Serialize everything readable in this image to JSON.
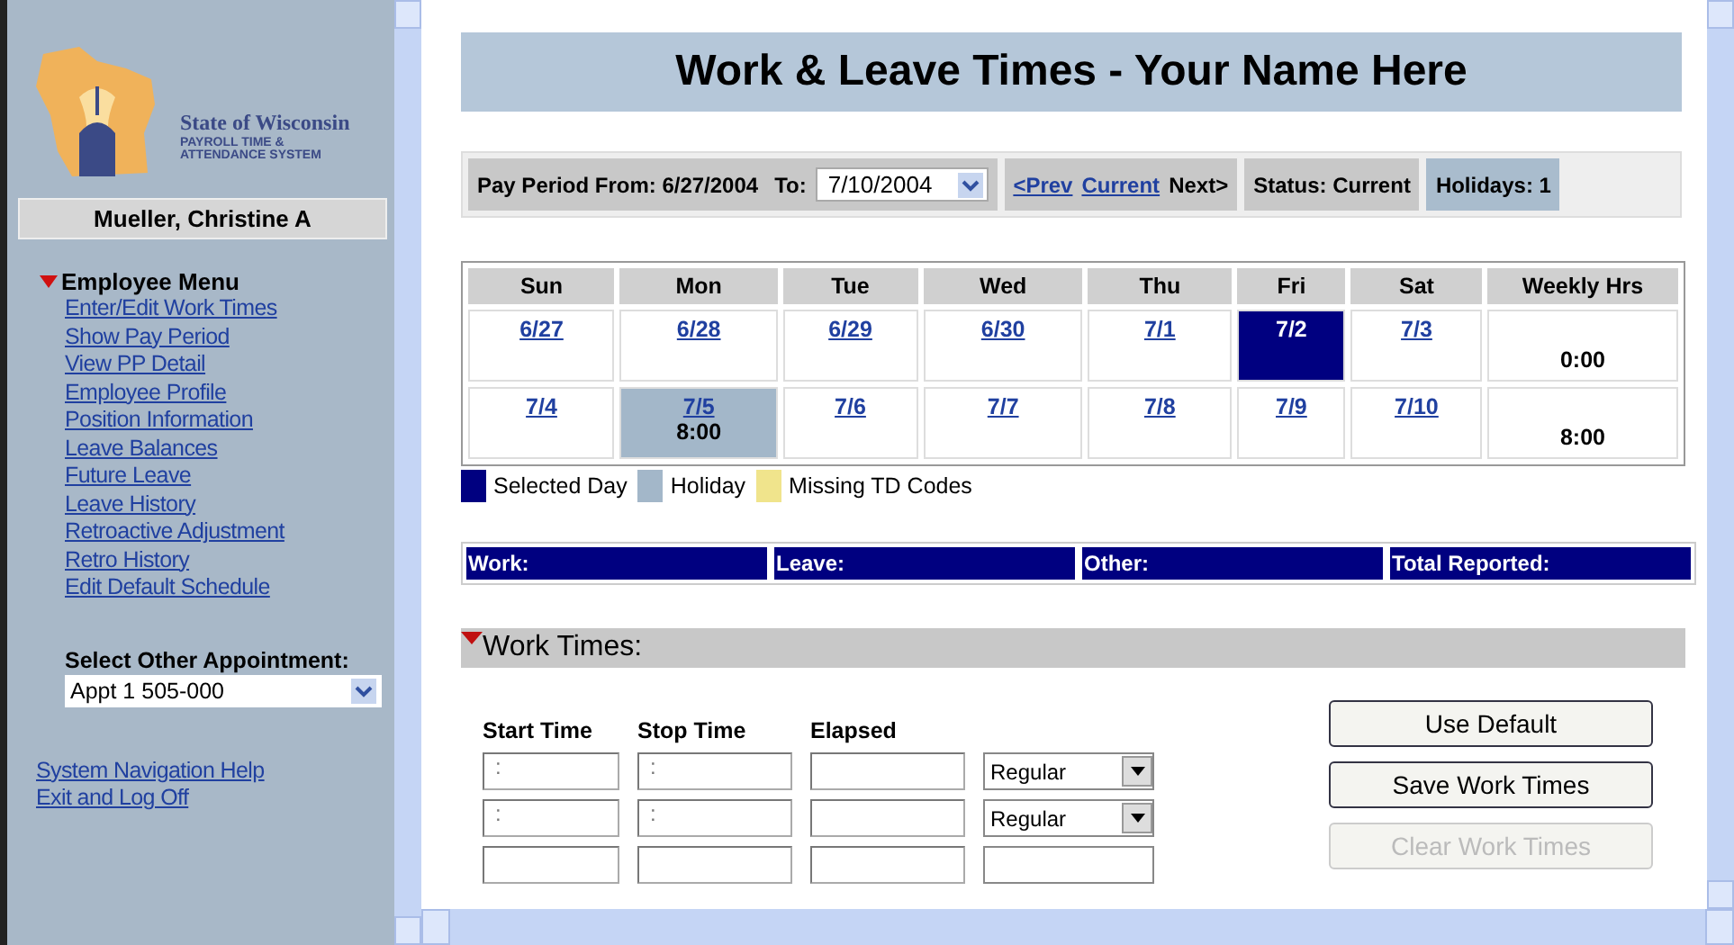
{
  "sidebar": {
    "logo": {
      "title": "State of Wisconsin",
      "subtitle_1": "PAYROLL TIME &",
      "subtitle_2": "ATTENDANCE SYSTEM"
    },
    "user": "Mueller, Christine A",
    "menu_title": "Employee Menu",
    "menu_expanded": true,
    "menu_items": [
      "Enter/Edit Work Times",
      "Show Pay Period",
      "View PP Detail",
      "Employee Profile",
      "Position Information",
      "Leave Balances",
      "Future Leave",
      "Leave History",
      "Retroactive Adjustment",
      "Retro History",
      "Edit Default Schedule"
    ],
    "appointment": {
      "label": "Select Other Appointment:",
      "value": "Appt 1 505-000"
    },
    "links": [
      "System Navigation Help",
      "Exit and Log Off"
    ]
  },
  "page_title": "Work & Leave Times -  Your Name Here",
  "pay_period": {
    "from_label": "Pay Period From: 6/27/2004",
    "to_label": "To:",
    "to_value": "7/10/2004",
    "nav": [
      {
        "label": "<Prev",
        "enabled": true
      },
      {
        "label": "Current",
        "enabled": true
      },
      {
        "label": "Next>",
        "enabled": false
      }
    ],
    "status": "Status: Current",
    "holidays": "Holidays: 1"
  },
  "calendar": {
    "columns": [
      "Sun",
      "Mon",
      "Tue",
      "Wed",
      "Thu",
      "Fri",
      "Sat",
      "Weekly Hrs"
    ],
    "weeks": [
      {
        "days": [
          {
            "date": "6/27",
            "selected": false,
            "holiday": false
          },
          {
            "date": "6/28",
            "selected": false,
            "holiday": false
          },
          {
            "date": "6/29",
            "selected": false,
            "holiday": false
          },
          {
            "date": "6/30",
            "selected": false,
            "holiday": false
          },
          {
            "date": "7/1",
            "selected": false,
            "holiday": false
          },
          {
            "date": "7/2",
            "selected": true,
            "holiday": false
          },
          {
            "date": "7/3",
            "selected": false,
            "holiday": false
          }
        ],
        "weekly_hrs": "0:00"
      },
      {
        "days": [
          {
            "date": "7/4",
            "selected": false,
            "holiday": false
          },
          {
            "date": "7/5",
            "hours": "8:00",
            "selected": false,
            "holiday": true
          },
          {
            "date": "7/6",
            "selected": false,
            "holiday": false
          },
          {
            "date": "7/7",
            "selected": false,
            "holiday": false
          },
          {
            "date": "7/8",
            "selected": false,
            "holiday": false
          },
          {
            "date": "7/9",
            "selected": false,
            "holiday": false
          },
          {
            "date": "7/10",
            "selected": false,
            "holiday": false
          }
        ],
        "weekly_hrs": "8:00"
      }
    ]
  },
  "legend": [
    {
      "label": "Selected Day",
      "color": "#000080"
    },
    {
      "label": "Holiday",
      "color": "#a3b7c9"
    },
    {
      "label": "Missing TD Codes",
      "color": "#f0e48c"
    }
  ],
  "totals": [
    "Work:",
    "Leave:",
    "Other:",
    "Total Reported:"
  ],
  "work_times": {
    "title": "Work Times:",
    "expanded": true,
    "columns": [
      "Start Time",
      "Stop Time",
      "Elapsed"
    ],
    "rows": [
      {
        "start": ":",
        "stop": ":",
        "type": "Regular"
      },
      {
        "start": ":",
        "stop": ":",
        "type": "Regular"
      }
    ],
    "buttons": [
      {
        "label": "Use Default",
        "disabled": false
      },
      {
        "label": "Save Work Times",
        "disabled": false
      },
      {
        "label": "Clear Work Times",
        "disabled": true
      }
    ]
  }
}
